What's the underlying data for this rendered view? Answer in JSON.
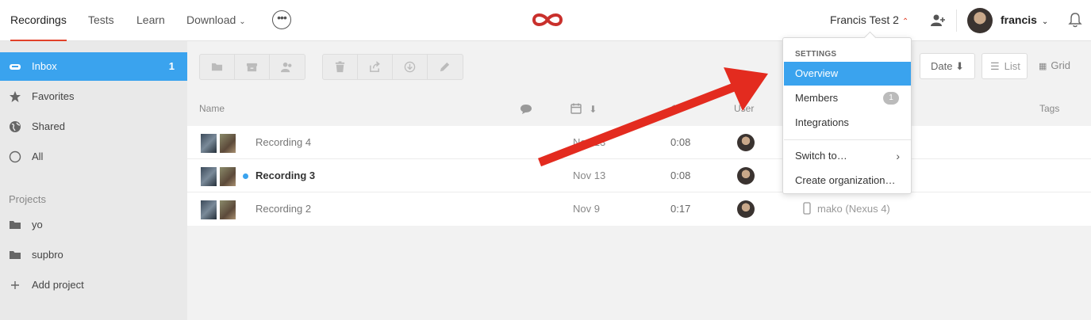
{
  "nav": {
    "recordings": "Recordings",
    "tests": "Tests",
    "learn": "Learn",
    "download": "Download"
  },
  "header": {
    "org_name": "Francis Test 2",
    "username": "francis"
  },
  "sidebar": {
    "items": [
      {
        "label": "Inbox",
        "count": "1",
        "icon": "inbox-icon"
      },
      {
        "label": "Favorites",
        "icon": "star-icon"
      },
      {
        "label": "Shared",
        "icon": "globe-icon"
      },
      {
        "label": "All",
        "icon": "circle-icon"
      }
    ],
    "projects_label": "Projects",
    "projects": [
      {
        "label": "yo",
        "icon": "folder-icon"
      },
      {
        "label": "supbro",
        "icon": "folder-icon"
      }
    ],
    "add_project": "Add project"
  },
  "toolbar": {
    "date_label": "Date ⬇",
    "list_label": "List",
    "grid_label": "Grid"
  },
  "table": {
    "headers": {
      "name": "Name",
      "user": "User",
      "tags": "Tags"
    },
    "rows": [
      {
        "name": "Recording 4",
        "date": "Nov 13",
        "duration": "0:08",
        "device": "",
        "unread": false
      },
      {
        "name": "Recording 3",
        "date": "Nov 13",
        "duration": "0:08",
        "device": "",
        "unread": true
      },
      {
        "name": "Recording 2",
        "date": "Nov 9",
        "duration": "0:17",
        "device": "mako (Nexus 4)",
        "unread": false
      }
    ]
  },
  "dropdown": {
    "heading": "SETTINGS",
    "overview": "Overview",
    "members": "Members",
    "members_count": "1",
    "integrations": "Integrations",
    "switch_to": "Switch to…",
    "create_org": "Create organization…"
  },
  "colors": {
    "accent": "#3aa3ee",
    "brand_red": "#e2412a",
    "annotation_arrow": "#e32b1f"
  }
}
